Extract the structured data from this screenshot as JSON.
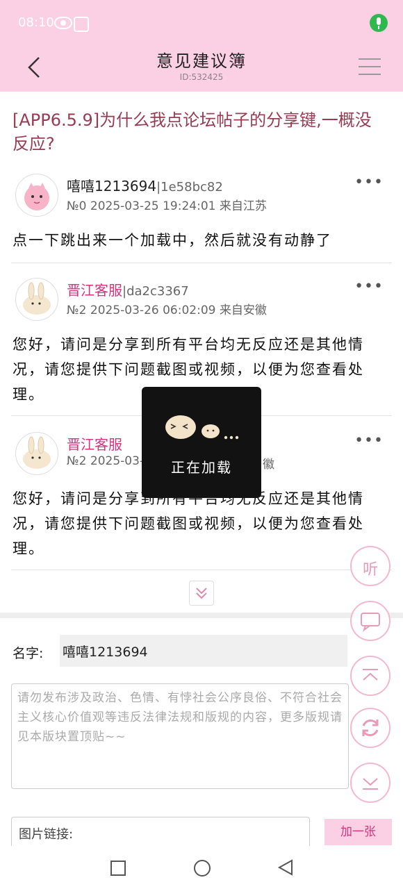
{
  "status_bar": {
    "time": "08:10"
  },
  "header": {
    "title": "意见建议簿",
    "id_label": "ID:532425"
  },
  "thread": {
    "title": "[APP6.5.9]为什么我点论坛帖子的分享键,一概没反应?"
  },
  "posts": [
    {
      "username": "嘻嘻1213694",
      "user_id": "|1e58bc82",
      "meta": "№0 2025-03-25 19:24:01 来自江苏",
      "content": "点一下跳出来一个加载中，然后就没有动静了"
    },
    {
      "username": "晋江客服",
      "user_id": "|da2c3367",
      "meta": "№2 2025-03-26 06:02:09 来自安徽",
      "content": "您好，请问是分享到所有平台均无反应还是其他情况，请您提供下问题截图或视频，以便为您查看处理。"
    },
    {
      "username": "晋江客服",
      "user_id": "",
      "meta_left": "№2 2025-03-",
      "meta_right": "徽",
      "content": "您好，请问是分享到所有平台均无反应还是其他情况，请您提供下问题截图或视频，以便为您查看处理。"
    }
  ],
  "reply_form": {
    "name_label": "名字:",
    "name_value": "嘻嘻1213694",
    "content_placeholder": "请勿发布涉及政治、色情、有悖社会公序良俗、不符合社会主义核心价值观等违反法律法规和版规的内容，更多版规请见本版块置顶贴~~",
    "image_link_label": "图片链接:",
    "add_one_button": "加一张"
  },
  "floating_buttons": {
    "listen": "听"
  },
  "loading_overlay": {
    "text": "正在加载"
  },
  "colors": {
    "header_bg": "#fbd0e4",
    "thread_title": "#9a3b54",
    "staff_name": "#d6327e",
    "accent_pink": "#e79bb6"
  }
}
